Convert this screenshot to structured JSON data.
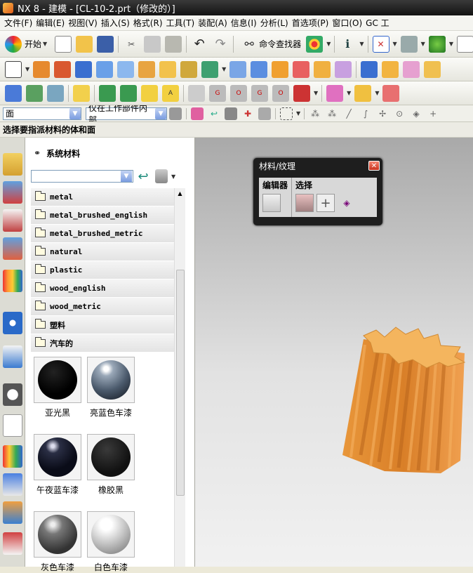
{
  "title": "NX 8 - 建模 - [CL-10-2.prt（修改的）]",
  "menu": [
    "文件(F)",
    "编辑(E)",
    "视图(V)",
    "插入(S)",
    "格式(R)",
    "工具(T)",
    "装配(A)",
    "信息(I)",
    "分析(L)",
    "首选项(P)",
    "窗口(O)",
    "GC 工"
  ],
  "toolbar": {
    "start_label": "开始",
    "command_finder": "命令查找器"
  },
  "selection": {
    "filter": "面",
    "scope": "仅在工作部件内部"
  },
  "cue": "选择要指派材料的体和面",
  "library": {
    "title": "系统材料",
    "folders": [
      "metal",
      "metal_brushed_english",
      "metal_brushed_metric",
      "natural",
      "plastic",
      "wood_english",
      "wood_metric",
      "塑料",
      "汽车的"
    ],
    "materials": [
      "亚光黑",
      "亮蓝色车漆",
      "午夜蓝车漆",
      "橡胶黑",
      "灰色车漆",
      "白色车漆"
    ]
  },
  "dialog": {
    "title": "材料/纹理",
    "editor": "编辑器",
    "select": "选择"
  },
  "colors": {
    "titlebar": "#1a1a1a",
    "viewport_top": "#a9a9a9",
    "part": "#e8973f",
    "part_top": "#f4b860"
  }
}
